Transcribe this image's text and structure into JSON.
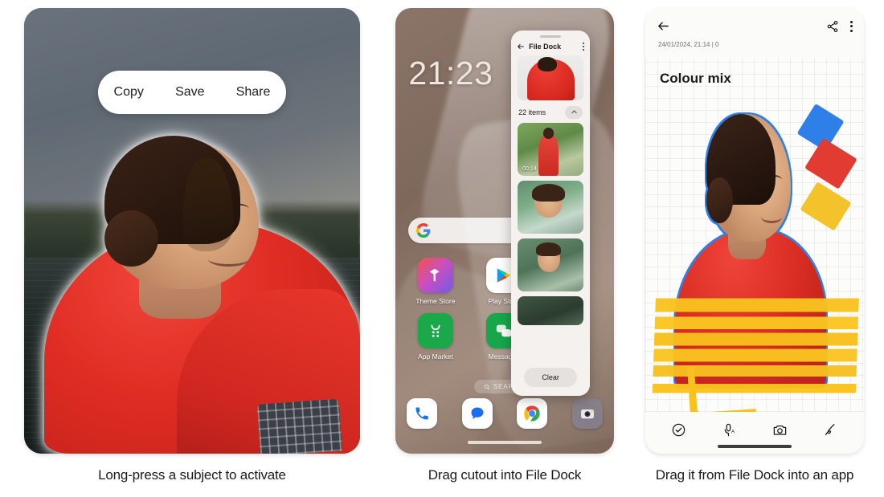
{
  "captions": [
    "Long-press a subject to activate",
    "Drag cutout into File Dock",
    "Drag it from File Dock into an app"
  ],
  "panel1": {
    "context_menu": {
      "copy_label": "Copy",
      "save_label": "Save",
      "share_label": "Share"
    }
  },
  "panel2": {
    "clock": "21:23",
    "search_pill": "SEARCH",
    "apps": [
      {
        "label": "Theme Store",
        "icon": "theme-store-icon"
      },
      {
        "label": "Play Store",
        "icon": "play-store-icon"
      },
      {
        "label": "App Market",
        "icon": "app-market-icon"
      },
      {
        "label": "Messages",
        "icon": "messages-icon"
      }
    ],
    "dock": [
      {
        "name": "phone-icon"
      },
      {
        "name": "messages-icon"
      },
      {
        "name": "chrome-icon"
      },
      {
        "name": "camera-icon"
      }
    ],
    "file_dock": {
      "title": "File Dock",
      "back_icon": "back-arrow-icon",
      "overflow_icon": "more-vertical-icon",
      "count_label": "22 items",
      "collapse_icon": "chevron-up-icon",
      "clear_label": "Clear",
      "items": [
        {
          "type": "video",
          "duration": "00:14"
        },
        {
          "type": "photo",
          "duration": ""
        },
        {
          "type": "photo",
          "duration": ""
        },
        {
          "type": "photo",
          "duration": ""
        }
      ]
    }
  },
  "panel3": {
    "back_icon": "back-arrow-icon",
    "share_icon": "share-icon",
    "overflow_icon": "more-vertical-icon",
    "meta": "24/01/2024, 21:14  |  0",
    "note_title": "Colour mix",
    "toolbar": [
      {
        "name": "checklist-icon"
      },
      {
        "name": "voice-recording-icon"
      },
      {
        "name": "camera-icon"
      },
      {
        "name": "pen-icon"
      }
    ],
    "marker_colors": {
      "blue": "#2F7FE8",
      "red": "#E23B32",
      "yellow": "#F4C22B"
    }
  }
}
